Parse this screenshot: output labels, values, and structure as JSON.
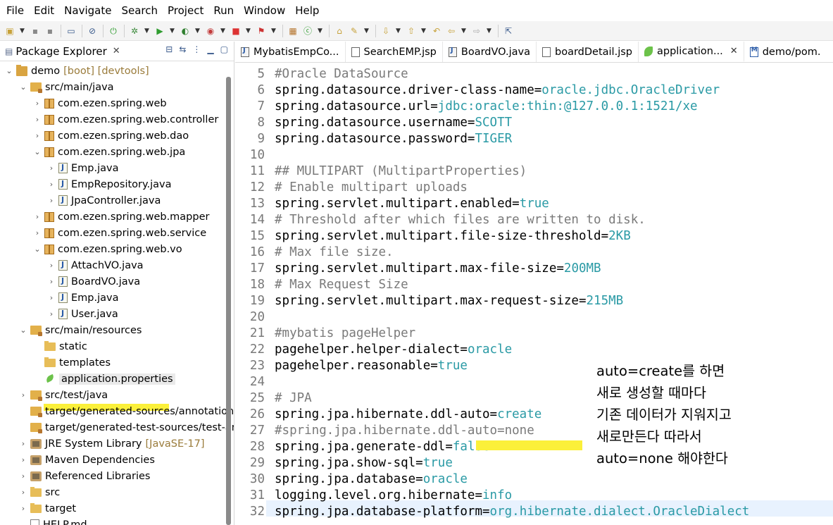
{
  "menu": [
    "File",
    "Edit",
    "Navigate",
    "Search",
    "Project",
    "Run",
    "Window",
    "Help"
  ],
  "explorer": {
    "title": "Package Explorer",
    "items": [
      {
        "label": "demo",
        "extra": "[boot] [devtools]"
      },
      {
        "label": "src/main/java"
      },
      {
        "label": "com.ezen.spring.web"
      },
      {
        "label": "com.ezen.spring.web.controller"
      },
      {
        "label": "com.ezen.spring.web.dao"
      },
      {
        "label": "com.ezen.spring.web.jpa"
      },
      {
        "label": "Emp.java"
      },
      {
        "label": "EmpRepository.java"
      },
      {
        "label": "JpaController.java"
      },
      {
        "label": "com.ezen.spring.web.mapper"
      },
      {
        "label": "com.ezen.spring.web.service"
      },
      {
        "label": "com.ezen.spring.web.vo"
      },
      {
        "label": "AttachVO.java"
      },
      {
        "label": "BoardVO.java"
      },
      {
        "label": "Emp.java"
      },
      {
        "label": "User.java"
      },
      {
        "label": "src/main/resources"
      },
      {
        "label": "static"
      },
      {
        "label": "templates"
      },
      {
        "label": "application.properties"
      },
      {
        "label": "src/test/java"
      },
      {
        "label": "target/generated-sources/annotation"
      },
      {
        "label": "target/generated-test-sources/test-an"
      },
      {
        "label": "JRE System Library",
        "extra": "[JavaSE-17]"
      },
      {
        "label": "Maven Dependencies"
      },
      {
        "label": "Referenced Libraries"
      },
      {
        "label": "src"
      },
      {
        "label": "target"
      },
      {
        "label": "HELP.md"
      }
    ]
  },
  "tabs": [
    {
      "label": "MybatisEmpCo..."
    },
    {
      "label": "SearchEMP.jsp"
    },
    {
      "label": "BoardVO.java"
    },
    {
      "label": "boardDetail.jsp"
    },
    {
      "label": "application..."
    },
    {
      "label": "demo/pom."
    }
  ],
  "code_lines": [
    {
      "n": "5",
      "key": "#Oracle DataSource",
      "val": ""
    },
    {
      "n": "6",
      "key": "spring.datasource.driver-class-name=",
      "val": "oracle.jdbc.OracleDriver"
    },
    {
      "n": "7",
      "key": "spring.datasource.url=",
      "val": "jdbc:oracle:thin:@127.0.0.1:1521/xe"
    },
    {
      "n": "8",
      "key": "spring.datasource.username=",
      "val": "SCOTT"
    },
    {
      "n": "9",
      "key": "spring.datasource.password=",
      "val": "TIGER"
    },
    {
      "n": "10",
      "key": "",
      "val": ""
    },
    {
      "n": "11",
      "key": "## MULTIPART (MultipartProperties)",
      "val": ""
    },
    {
      "n": "12",
      "key": "# Enable multipart uploads",
      "val": ""
    },
    {
      "n": "13",
      "key": "spring.servlet.multipart.enabled=",
      "val": "true"
    },
    {
      "n": "14",
      "key": "# Threshold after which files are written to disk.",
      "val": ""
    },
    {
      "n": "15",
      "key": "spring.servlet.multipart.file-size-threshold=",
      "val": "2KB"
    },
    {
      "n": "16",
      "key": "# Max file size.",
      "val": ""
    },
    {
      "n": "17",
      "key": "spring.servlet.multipart.max-file-size=",
      "val": "200MB"
    },
    {
      "n": "18",
      "key": "# Max Request Size",
      "val": ""
    },
    {
      "n": "19",
      "key": "spring.servlet.multipart.max-request-size=",
      "val": "215MB"
    },
    {
      "n": "20",
      "key": "",
      "val": ""
    },
    {
      "n": "21",
      "key": "#mybatis pageHelper",
      "val": ""
    },
    {
      "n": "22",
      "key": "pagehelper.helper-dialect=",
      "val": "oracle"
    },
    {
      "n": "23",
      "key": "pagehelper.reasonable=",
      "val": "true"
    },
    {
      "n": "24",
      "key": "",
      "val": ""
    },
    {
      "n": "25",
      "key": "# JPA",
      "val": ""
    },
    {
      "n": "26",
      "key": "spring.jpa.hibernate.ddl-auto=",
      "val": "create"
    },
    {
      "n": "27",
      "key": "#spring.jpa.hibernate.ddl-auto=none",
      "val": ""
    },
    {
      "n": "28",
      "key": "spring.jpa.generate-ddl=",
      "val": "false"
    },
    {
      "n": "29",
      "key": "spring.jpa.show-sql=",
      "val": "true"
    },
    {
      "n": "30",
      "key": "spring.jpa.database=",
      "val": "oracle"
    },
    {
      "n": "31",
      "key": "logging.level.org.hibernate=",
      "val": "info"
    },
    {
      "n": "32",
      "key": "spring.jpa.database-platform=",
      "val": "org.hibernate.dialect.OracleDialect"
    }
  ],
  "annotation": [
    "auto=create를 하면",
    "새로 생성할 때마다",
    "기존 데이터가 지워지고",
    "새로만든다 따라서",
    "auto=none 해야한다"
  ],
  "colors": {
    "value": "#2a9aa5",
    "comment": "#7a7a7a",
    "highlighter": "#fbf03a"
  }
}
